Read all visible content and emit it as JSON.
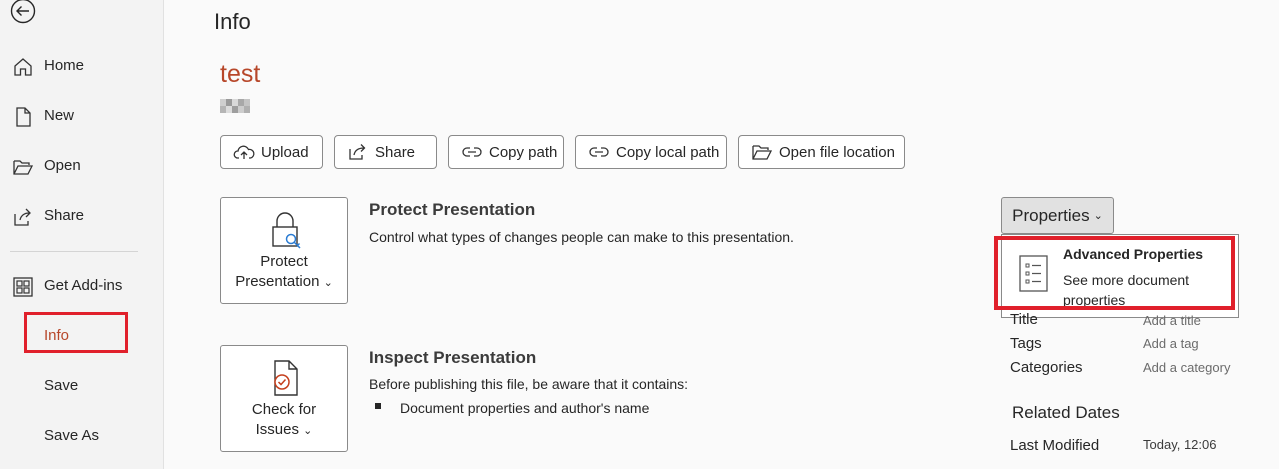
{
  "sidebar": {
    "items": [
      {
        "label": "Home",
        "icon": "home-icon"
      },
      {
        "label": "New",
        "icon": "new-document-icon"
      },
      {
        "label": "Open",
        "icon": "open-folder-icon"
      },
      {
        "label": "Share",
        "icon": "share-icon"
      },
      {
        "label": "Get Add-ins",
        "icon": "addins-icon"
      },
      {
        "label": "Info"
      },
      {
        "label": "Save"
      },
      {
        "label": "Save As"
      }
    ],
    "selected": "Info",
    "highlight_color": "#e0202b"
  },
  "page": {
    "title": "Info",
    "doc_title": "test",
    "doc_title_color": "#b7472a"
  },
  "actions": {
    "upload": "Upload",
    "share": "Share",
    "copy_path": "Copy path",
    "copy_local_path": "Copy local path",
    "open_file_location": "Open file location"
  },
  "protect": {
    "tile_line1": "Protect",
    "tile_line2": "Presentation",
    "title": "Protect Presentation",
    "description": "Control what types of changes people can make to this presentation."
  },
  "inspect": {
    "tile_line1": "Check for",
    "tile_line2": "Issues",
    "title": "Inspect Presentation",
    "description": "Before publishing this file, be aware that it contains:",
    "bullets": [
      "Document properties and author's name"
    ]
  },
  "properties": {
    "button_label": "Properties",
    "menu": {
      "title": "Advanced Properties",
      "description": "See more document properties"
    },
    "fields": [
      {
        "label": "Title",
        "value": "Add a title"
      },
      {
        "label": "Tags",
        "value": "Add a tag"
      },
      {
        "label": "Categories",
        "value": "Add a category"
      }
    ]
  },
  "related_dates": {
    "title": "Related Dates",
    "items": [
      {
        "label": "Last Modified",
        "value": "Today, 12:06"
      }
    ]
  }
}
